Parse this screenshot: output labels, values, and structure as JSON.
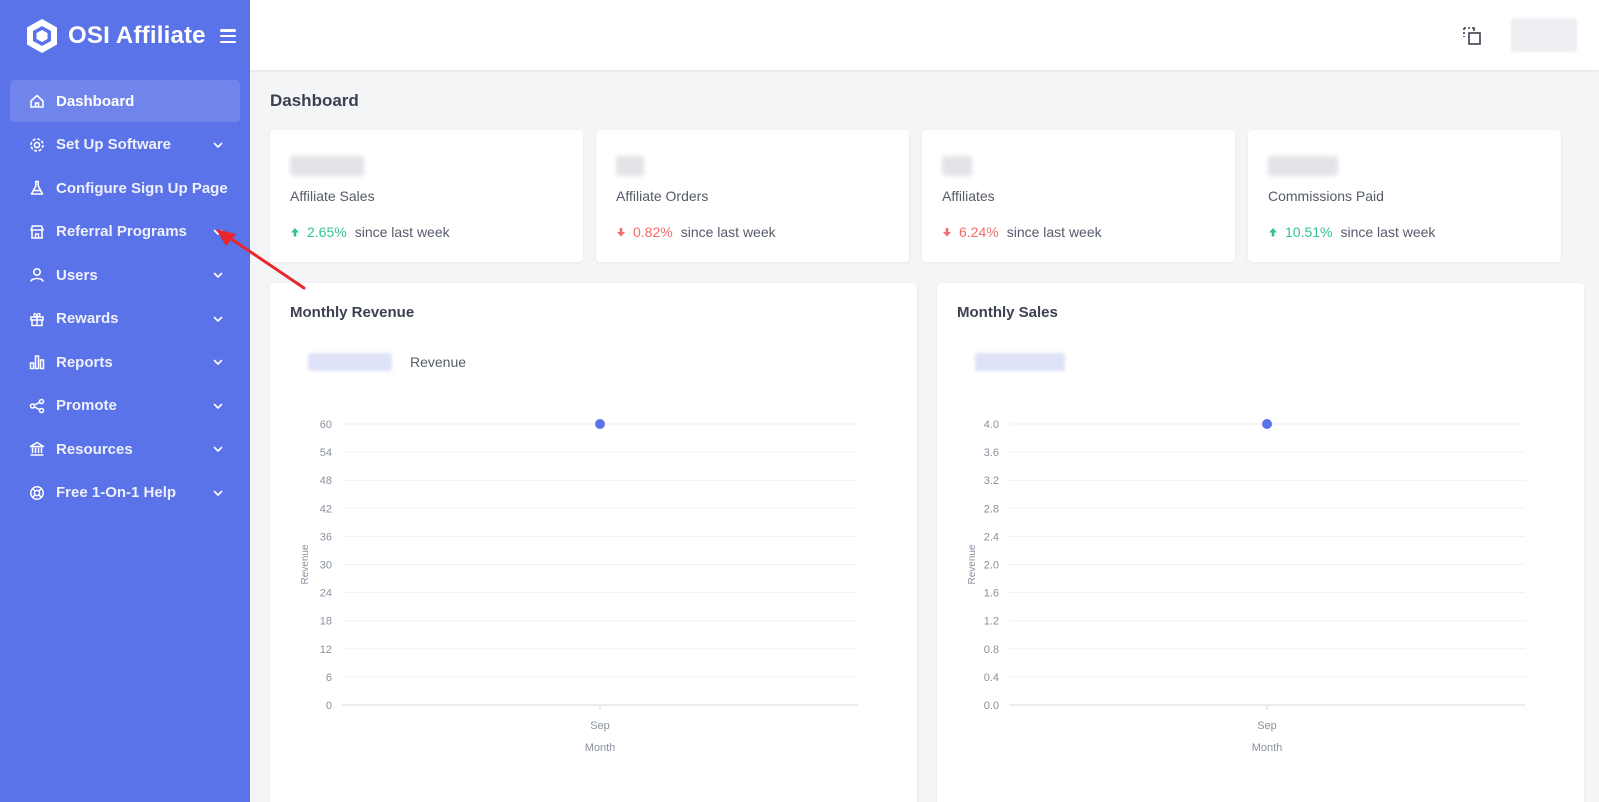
{
  "brand": {
    "name": "OSI Affiliate"
  },
  "sidebar": {
    "items": [
      {
        "label": "Dashboard",
        "icon": "home-icon",
        "active": true,
        "has_submenu": false
      },
      {
        "label": "Set Up Software",
        "icon": "gear-icon",
        "active": false,
        "has_submenu": true
      },
      {
        "label": "Configure Sign Up Page",
        "icon": "flask-icon",
        "active": false,
        "has_submenu": false
      },
      {
        "label": "Referral Programs",
        "icon": "store-icon",
        "active": false,
        "has_submenu": true
      },
      {
        "label": "Users",
        "icon": "user-icon",
        "active": false,
        "has_submenu": true
      },
      {
        "label": "Rewards",
        "icon": "gift-icon",
        "active": false,
        "has_submenu": true
      },
      {
        "label": "Reports",
        "icon": "bar-chart-icon",
        "active": false,
        "has_submenu": true
      },
      {
        "label": "Promote",
        "icon": "share-icon",
        "active": false,
        "has_submenu": true
      },
      {
        "label": "Resources",
        "icon": "bank-icon",
        "active": false,
        "has_submenu": true
      },
      {
        "label": "Free 1-On-1 Help",
        "icon": "lifebuoy-icon",
        "active": false,
        "has_submenu": true
      }
    ]
  },
  "page": {
    "title": "Dashboard"
  },
  "stats": [
    {
      "label": "Affiliate Sales",
      "change": "2.65%",
      "direction": "up",
      "suffix": "since last week"
    },
    {
      "label": "Affiliate Orders",
      "change": "0.82%",
      "direction": "down",
      "suffix": "since last week"
    },
    {
      "label": "Affiliates",
      "change": "6.24%",
      "direction": "down",
      "suffix": "since last week"
    },
    {
      "label": "Commissions Paid",
      "change": "10.51%",
      "direction": "up",
      "suffix": "since last week"
    }
  ],
  "colors": {
    "sidebar": "#5b73e8",
    "accent": "#5b73e8",
    "up": "#34c38f",
    "down": "#f46a6a",
    "annotation": "#e8262b"
  },
  "chart_data": [
    {
      "type": "scatter",
      "title": "Monthly Revenue",
      "legend": [
        "Revenue"
      ],
      "xlabel": "Month",
      "ylabel": "Revenue",
      "categories": [
        "Sep"
      ],
      "ylim": [
        0,
        60
      ],
      "yticks": [
        "0",
        "6",
        "12",
        "18",
        "24",
        "30",
        "36",
        "42",
        "48",
        "54",
        "60"
      ],
      "series": [
        {
          "name": "Revenue",
          "values": [
            60
          ]
        }
      ]
    },
    {
      "type": "scatter",
      "title": "Monthly Sales",
      "legend": [],
      "xlabel": "Month",
      "ylabel": "Revenue",
      "categories": [
        "Sep"
      ],
      "ylim": [
        0,
        4.0
      ],
      "yticks": [
        "0.0",
        "0.4",
        "0.8",
        "1.2",
        "1.6",
        "2.0",
        "2.4",
        "2.8",
        "3.2",
        "3.6",
        "4.0"
      ],
      "series": [
        {
          "values": [
            4.0
          ]
        }
      ]
    }
  ]
}
